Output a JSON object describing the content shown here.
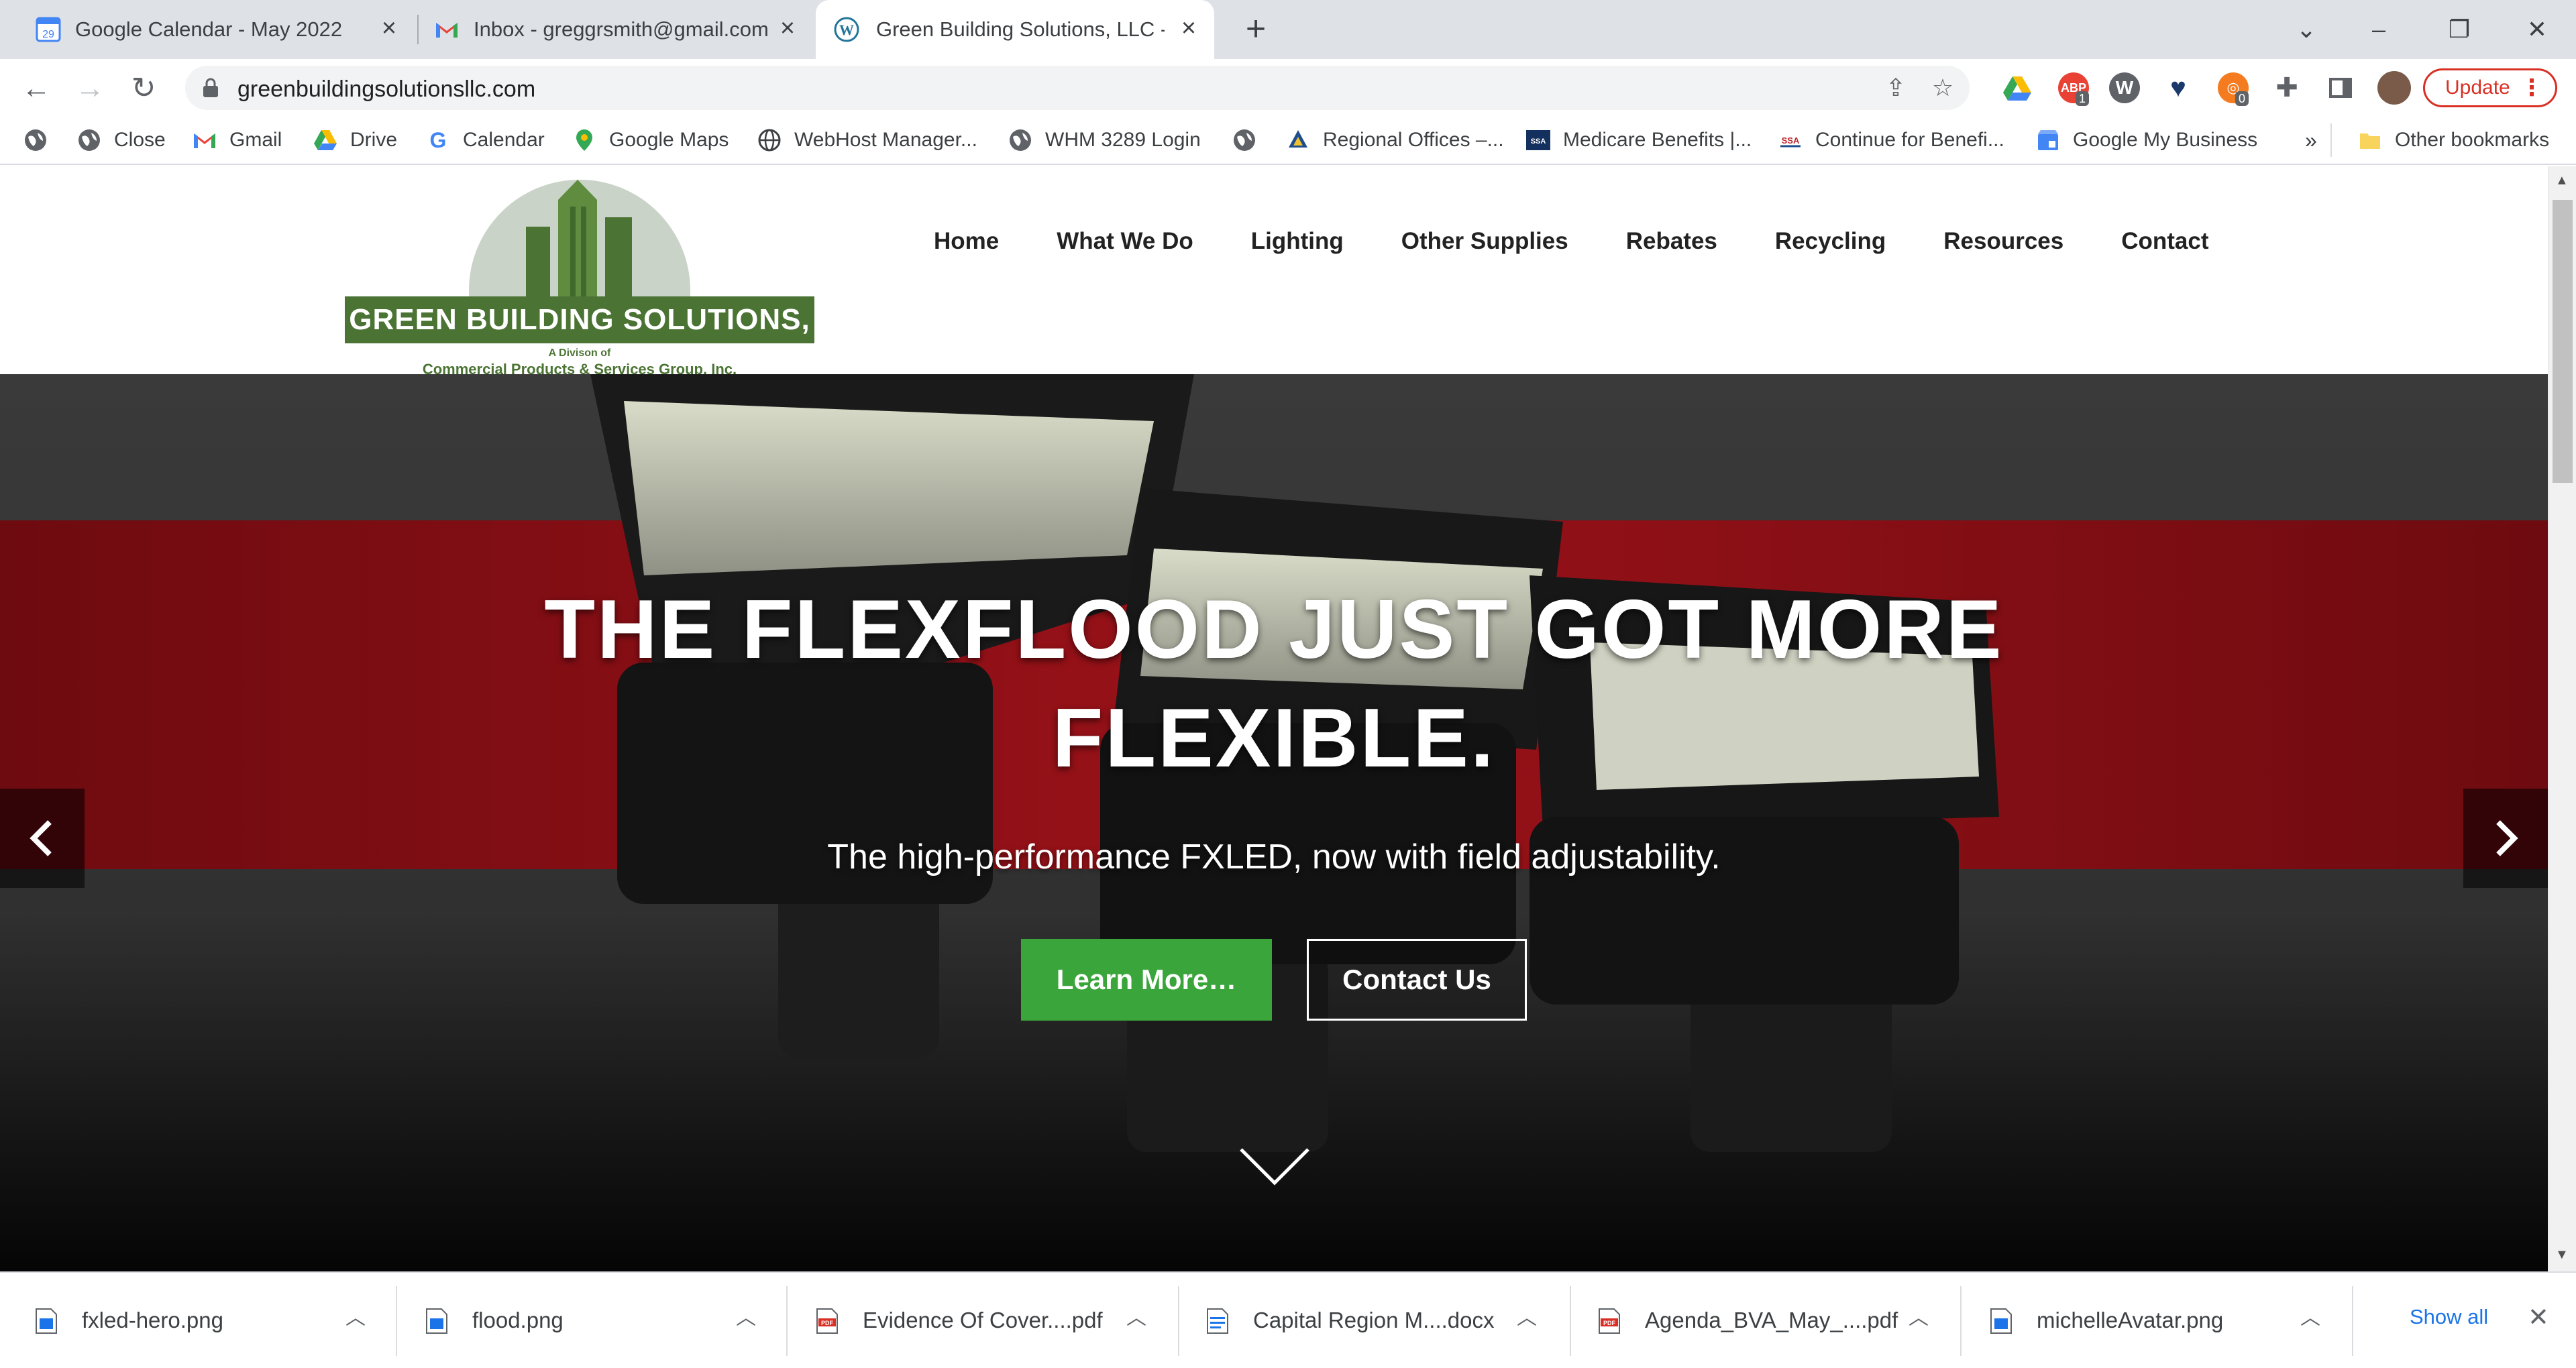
{
  "browser": {
    "tabs": [
      {
        "title": "Google Calendar - May 2022",
        "favicon": "calendar-icon",
        "active": false
      },
      {
        "title": "Inbox - greggrsmith@gmail.com",
        "favicon": "gmail-icon",
        "active": false
      },
      {
        "title": "Green Building Solutions, LLC - N",
        "favicon": "wordpress-icon",
        "active": true
      }
    ],
    "url": "greenbuildingsolutionsllc.com",
    "update_label": "Update",
    "bookmarks": [
      {
        "label": "",
        "icon": "globe-icon"
      },
      {
        "label": "Close",
        "icon": "globe-icon"
      },
      {
        "label": "Gmail",
        "icon": "gmail-icon"
      },
      {
        "label": "Drive",
        "icon": "drive-icon"
      },
      {
        "label": "Calendar",
        "icon": "google-icon"
      },
      {
        "label": "Google Maps",
        "icon": "maps-pin-icon"
      },
      {
        "label": "WebHost Manager...",
        "icon": "globe-icon"
      },
      {
        "label": "WHM 3289 Login",
        "icon": "globe-icon"
      },
      {
        "label": "",
        "icon": "globe-icon"
      },
      {
        "label": "Regional Offices –...",
        "icon": "shield-icon"
      },
      {
        "label": "Medicare Benefits |...",
        "icon": "ssa-icon"
      },
      {
        "label": "Continue for Benefi...",
        "icon": "ssa-icon"
      },
      {
        "label": "Google My Business",
        "icon": "business-icon"
      }
    ],
    "overflow_label": "»",
    "other_bookmarks": "Other bookmarks",
    "extension_badges": [
      "1",
      "0"
    ]
  },
  "site": {
    "logo": {
      "name": "GREEN BUILDING SOLUTIONS, LLC",
      "sub1": "A Divison of",
      "sub2": "Commercial Products & Services Group, Inc."
    },
    "nav": [
      "Home",
      "What We Do",
      "Lighting",
      "Other Supplies",
      "Rebates",
      "Recycling",
      "Resources",
      "Contact"
    ],
    "hero": {
      "title_line1": "THE FLEXFLOOD JUST GOT MORE",
      "title_line2": "FLEXIBLE.",
      "subtitle": "The high-performance FXLED, now with field adjustability.",
      "learn_more": "Learn More…",
      "contact_us": "Contact Us"
    }
  },
  "downloads": {
    "items": [
      {
        "name": "fxled-hero.png",
        "type": "image"
      },
      {
        "name": "flood.png",
        "type": "image"
      },
      {
        "name": "Evidence Of Cover....pdf",
        "type": "pdf"
      },
      {
        "name": "Capital Region M....docx",
        "type": "doc"
      },
      {
        "name": "Agenda_BVA_May_....pdf",
        "type": "pdf"
      },
      {
        "name": "michelleAvatar.png",
        "type": "image"
      }
    ],
    "show_all": "Show all"
  },
  "colors": {
    "brand_green": "#4b7434",
    "button_green": "#3aa53a",
    "hero_red": "#8b0f14",
    "update_red": "#d93025",
    "link_blue": "#1a73e8"
  }
}
